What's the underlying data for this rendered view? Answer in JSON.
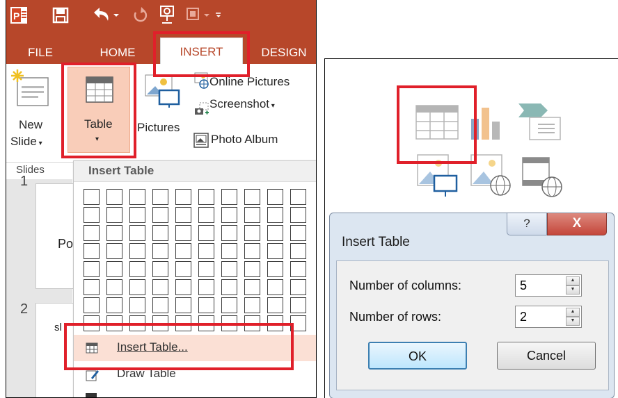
{
  "ribbon": {
    "tabs": [
      "FILE",
      "HOME",
      "INSERT",
      "DESIGN"
    ],
    "new_slide_label_1": "New",
    "new_slide_label_2": "Slide",
    "table_label": "Table",
    "pictures_label": "Pictures",
    "online_pictures_label": "Online Pictures",
    "screenshot_label": "Screenshot",
    "photo_album_label": "Photo Album",
    "slides_group_label": "Slides"
  },
  "slide_panel": {
    "slide_numbers": [
      "1",
      "2"
    ],
    "slide1_text": "Po",
    "slide2_text": "sl"
  },
  "dropdown": {
    "header": "Insert Table",
    "grid": {
      "columns": 10,
      "rows": 8
    },
    "insert_table_item": "Insert Table...",
    "draw_table_item": "Draw Table"
  },
  "dialog": {
    "title": "Insert Table",
    "help_label": "?",
    "close_label": "X",
    "columns_label": "Number of columns:",
    "columns_value": "5",
    "rows_label": "Number of rows:",
    "rows_value": "2",
    "ok_label": "OK",
    "cancel_label": "Cancel"
  },
  "colors": {
    "accent": "#b7472a",
    "highlight": "#e0202a",
    "table_button_bg": "#f9cdb9"
  },
  "icons": [
    "powerpoint-logo-icon",
    "save-icon",
    "undo-icon",
    "redo-icon",
    "present-icon",
    "table-icon",
    "chart-icon",
    "smartart-icon",
    "pictures-icon",
    "online-pictures-icon",
    "screenshot-icon",
    "photo-album-icon",
    "video-icon"
  ]
}
